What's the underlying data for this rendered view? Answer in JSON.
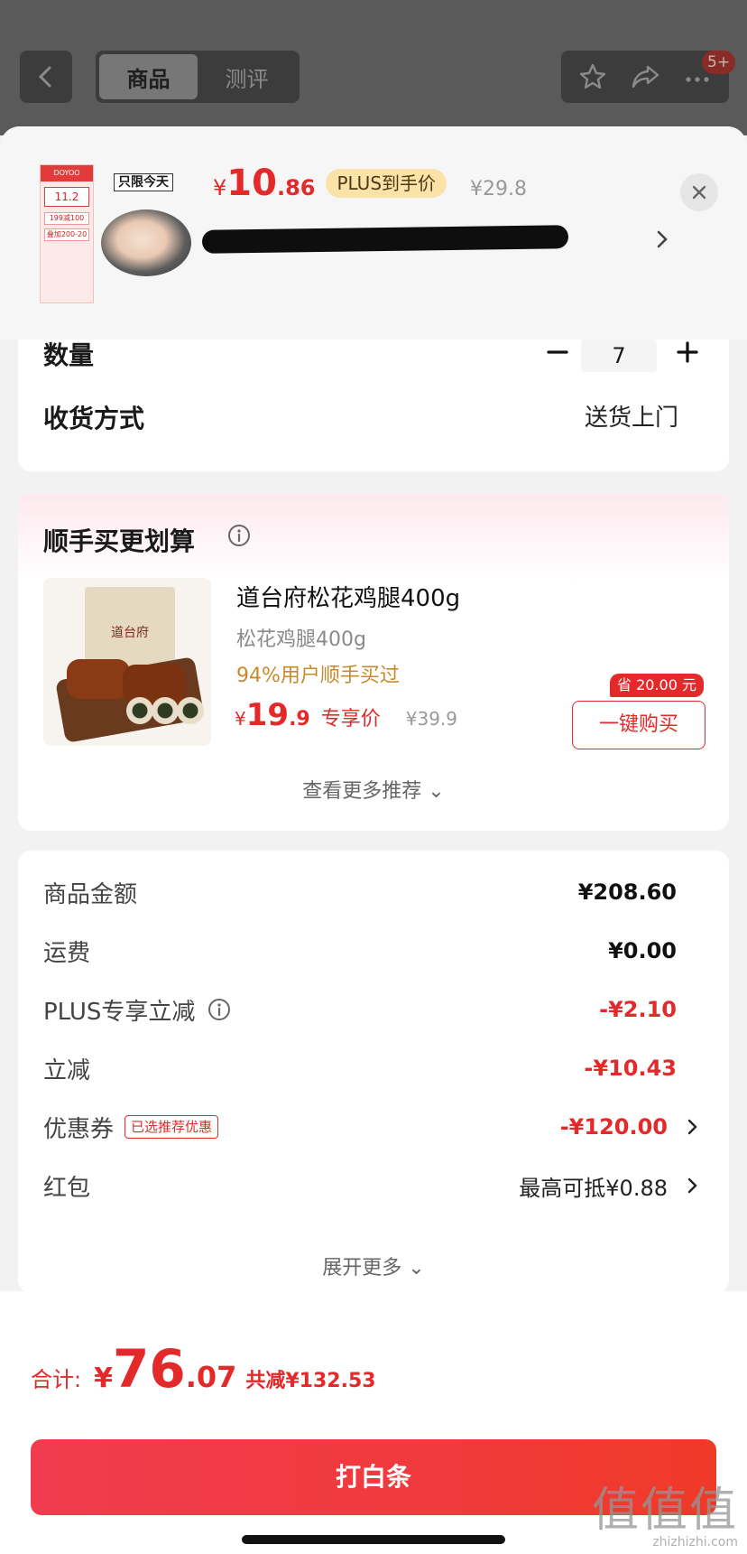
{
  "nav": {
    "tabs": [
      {
        "label": "商品",
        "active": true
      },
      {
        "label": "测评",
        "active": false
      }
    ],
    "message_badge": "5+"
  },
  "product": {
    "limited_tag": "只限今天",
    "price_symbol": "¥",
    "price_int": "10",
    "price_dec": ".86",
    "plus_label": "PLUS到手价",
    "original_price": "¥29.8",
    "poster_price": "11.2",
    "poster_line1": "199减100",
    "poster_line2": "叠加200-20"
  },
  "quantity": {
    "label": "数量",
    "value": "7"
  },
  "delivery": {
    "label": "收货方式",
    "value": "送货上门"
  },
  "recommend": {
    "title": "顺手买更划算",
    "item": {
      "bag_brand": "道台府",
      "name": "道台府松花鸡腿400g",
      "sub": "松花鸡腿400g",
      "rate": "94%用户顺手买过",
      "price_symbol": "¥",
      "price_int": "19",
      "price_dec": ".9",
      "price_label": "专享价",
      "original_price": "¥39.9",
      "save_tag": "省 20.00 元",
      "buy_label": "一键购买"
    },
    "more_label": "查看更多推荐 ⌄"
  },
  "summary": {
    "rows": [
      {
        "label": "商品金额",
        "value": "¥208.60"
      },
      {
        "label": "运费",
        "value": "¥0.00"
      },
      {
        "label": "PLUS专享立减",
        "value": "-¥2.10"
      },
      {
        "label": "立减",
        "value": "-¥10.43"
      },
      {
        "label": "优惠券",
        "tag": "已选推荐优惠",
        "value": "-¥120.00"
      },
      {
        "label": "红包",
        "value": "最高可抵¥0.88"
      }
    ],
    "expand_label": "展开更多 ⌄"
  },
  "footer": {
    "total_label": "合计:",
    "total_symbol": "¥",
    "total_int": "76",
    "total_dec": ".07",
    "total_saved": "共减¥132.53",
    "pay_label": "打白条"
  },
  "watermark": {
    "big": "值值值",
    "small": "zhizhizhi.com"
  },
  "colors": {
    "accent_red": "#e4292a",
    "plus_gold": "#fae2a8",
    "rate_orange": "#c68a2c"
  }
}
